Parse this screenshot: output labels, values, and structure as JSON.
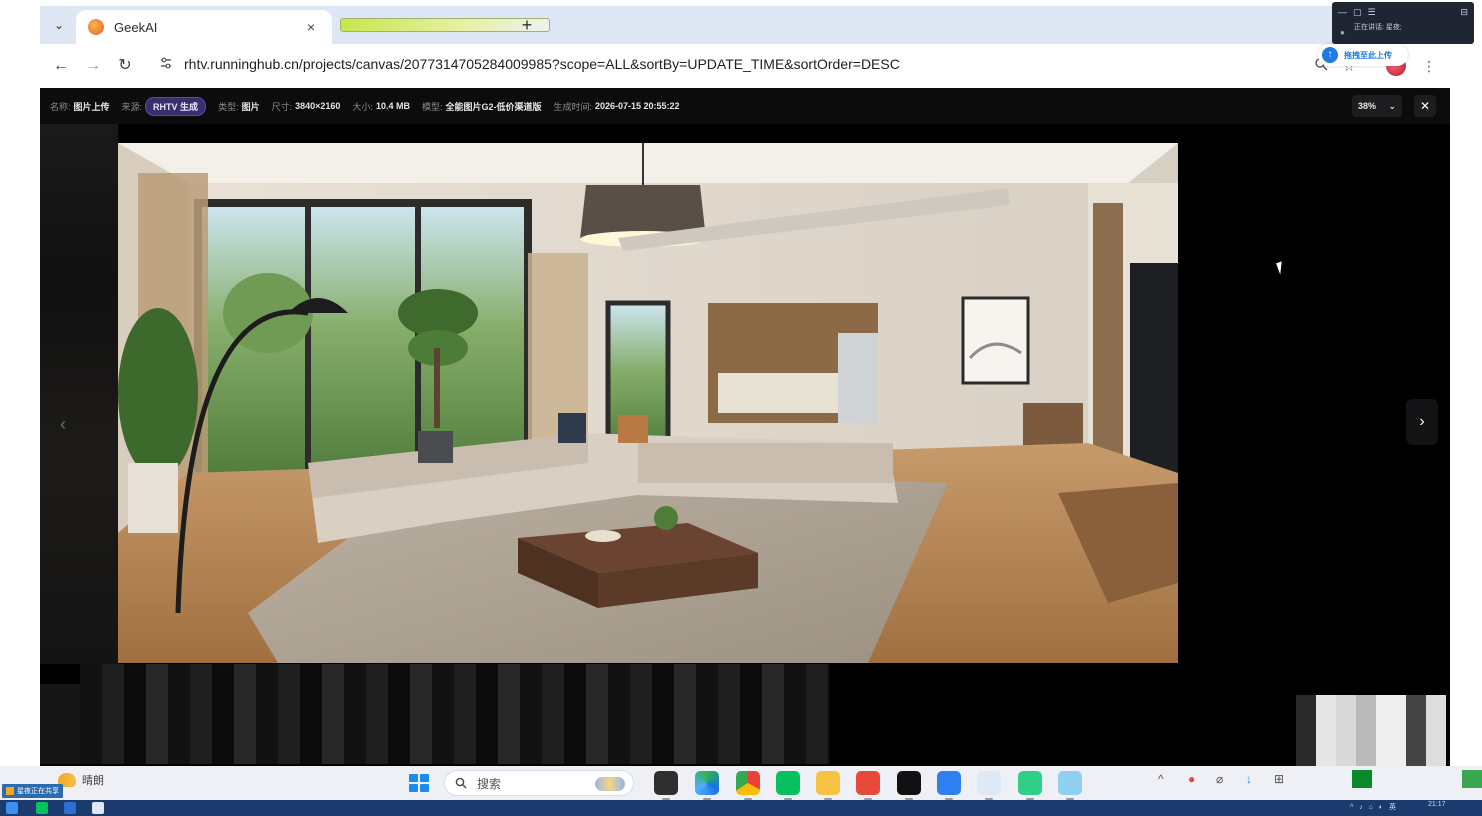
{
  "tab": {
    "title": "GeekAI",
    "close_symbol": "×",
    "new_tab_symbol": "+",
    "list_symbol": "⌄"
  },
  "toolbar": {
    "back_symbol": "←",
    "forward_symbol": "→",
    "reload_symbol": "↻",
    "url": "rhtv.runninghub.cn/projects/canvas/2077314705284009985?scope=ALL&sortBy=UPDATE_TIME&sortOrder=DESC",
    "menu_symbol": "⋮"
  },
  "viewer": {
    "name_label": "名称:",
    "name_value": "图片上传",
    "source_label": "来源:",
    "source_value": "RHTV 生成",
    "type_label": "类型:",
    "type_value": "图片",
    "size_label": "尺寸:",
    "size_value": "3840×2160",
    "filesize_label": "大小:",
    "filesize_value": "10.4 MB",
    "model_label": "模型:",
    "model_value": "全能图片G2-低价渠道版",
    "time_label": "生成时间:",
    "time_value": "2026-07-15 20:55:22",
    "zoom_value": "38%",
    "zoom_chevron": "⌄",
    "close_symbol": "✕",
    "prev_symbol": "‹",
    "next_symbol": "›"
  },
  "share": {
    "status_text": "正在讲话: 星夜;",
    "upload_text": "拖拽至此上传"
  },
  "taskbar": {
    "weather_text": "晴朗",
    "search_placeholder": "搜索",
    "share_tag": "星夜正在共享",
    "clock": "21:17"
  },
  "colors": {
    "tab_strip": "#dfe6f3",
    "viewer_bg": "#0c0c0d",
    "source_pill": "#3a2f6d",
    "taskbar": "#eef0f5"
  }
}
